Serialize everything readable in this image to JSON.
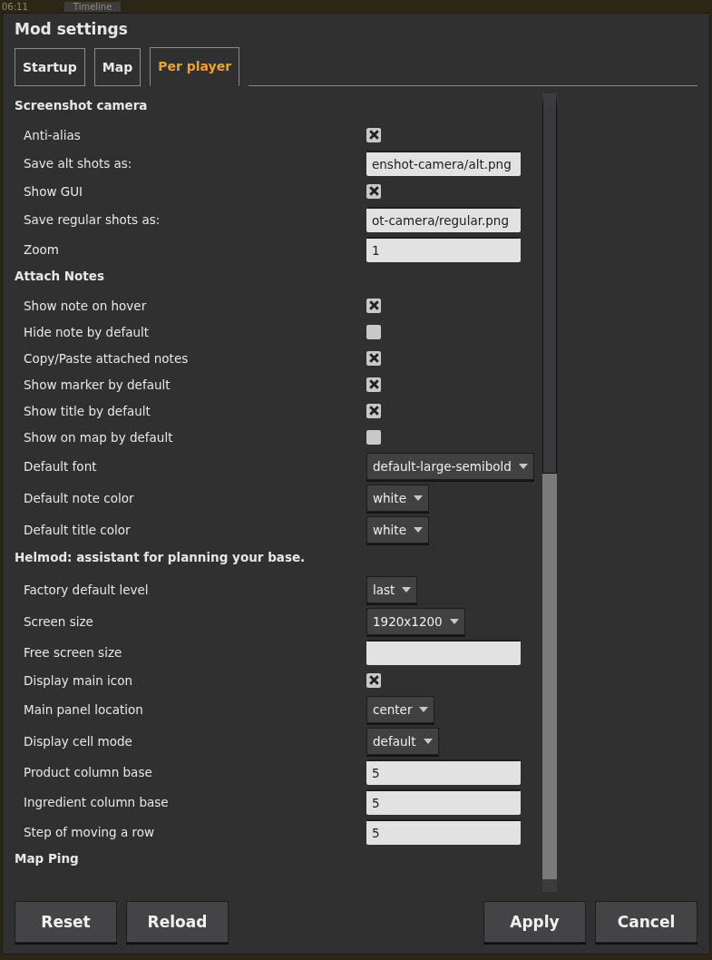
{
  "background": {
    "clock": "06:11",
    "button": "Timeline"
  },
  "window": {
    "title": "Mod settings"
  },
  "tabs": [
    {
      "label": "Startup",
      "selected": false
    },
    {
      "label": "Map",
      "selected": false
    },
    {
      "label": "Per player",
      "selected": true
    }
  ],
  "sections": [
    {
      "title": "Screenshot camera",
      "settings": [
        {
          "kind": "checkbox",
          "label": "Anti-alias",
          "checked": true
        },
        {
          "kind": "text",
          "label": "Save alt shots as:",
          "value": "enshot-camera/alt.png"
        },
        {
          "kind": "checkbox",
          "label": "Show GUI",
          "checked": true
        },
        {
          "kind": "text",
          "label": "Save regular shots as:",
          "value": "ot-camera/regular.png"
        },
        {
          "kind": "text",
          "label": "Zoom",
          "value": "1"
        }
      ]
    },
    {
      "title": "Attach Notes",
      "settings": [
        {
          "kind": "checkbox",
          "label": "Show note on hover",
          "checked": true
        },
        {
          "kind": "checkbox",
          "label": "Hide note by default",
          "checked": false
        },
        {
          "kind": "checkbox",
          "label": "Copy/Paste attached notes",
          "checked": true
        },
        {
          "kind": "checkbox",
          "label": "Show marker by default",
          "checked": true
        },
        {
          "kind": "checkbox",
          "label": "Show title by default",
          "checked": true
        },
        {
          "kind": "checkbox",
          "label": "Show on map by default",
          "checked": false
        },
        {
          "kind": "dropdown",
          "label": "Default font",
          "value": "default-large-semibold"
        },
        {
          "kind": "dropdown",
          "label": "Default note color",
          "value": "white"
        },
        {
          "kind": "dropdown",
          "label": "Default title color",
          "value": "white"
        }
      ]
    },
    {
      "title": "Helmod: assistant for planning your base.",
      "settings": [
        {
          "kind": "dropdown",
          "label": "Factory default level",
          "value": "last"
        },
        {
          "kind": "dropdown",
          "label": "Screen size",
          "value": "1920x1200"
        },
        {
          "kind": "text",
          "label": "Free screen size"
        },
        {
          "kind": "checkbox",
          "label": "Display main icon",
          "checked": true
        },
        {
          "kind": "dropdown",
          "label": "Main panel location",
          "value": "center"
        },
        {
          "kind": "dropdown",
          "label": "Display cell mode",
          "value": "default"
        },
        {
          "kind": "text",
          "label": "Product column base",
          "value": "5"
        },
        {
          "kind": "text",
          "label": "Ingredient column base",
          "value": "5"
        },
        {
          "kind": "text",
          "label": "Step of moving a row",
          "value": "5"
        }
      ]
    },
    {
      "title": "Map Ping"
    }
  ],
  "buttons_left": [
    "Reset",
    "Reload"
  ],
  "buttons_right": [
    "Apply",
    "Cancel"
  ]
}
